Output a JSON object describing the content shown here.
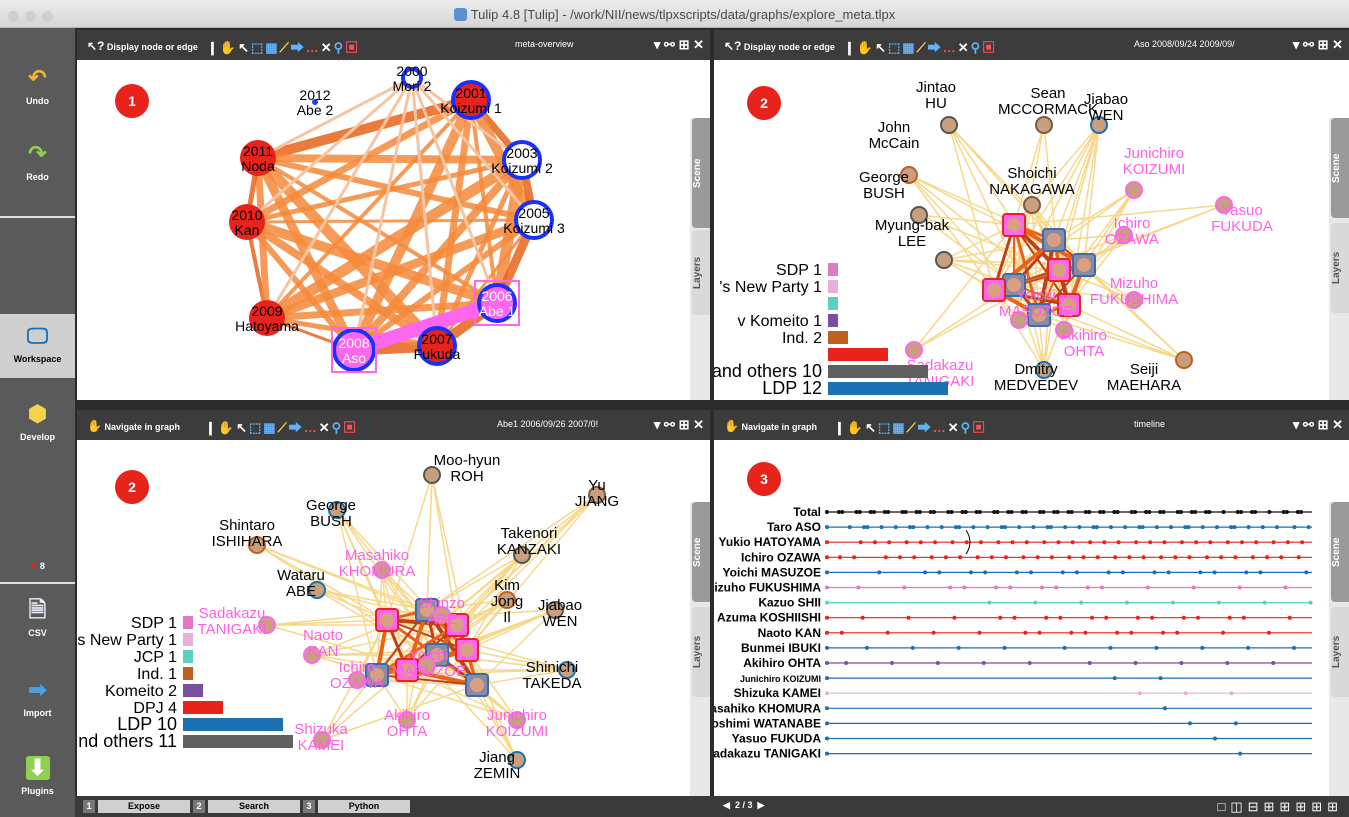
{
  "window": {
    "title": "Tulip 4.8 [Tulip] - /work/NII/news/tlpxscripts/data/graphs/explore_meta.tlpx"
  },
  "sidebar": {
    "undo": "Undo",
    "redo": "Redo",
    "workspace": "Workspace",
    "develop": "Develop",
    "errors": "8",
    "csv": "CSV",
    "import": "Import",
    "plugins": "Plugins"
  },
  "panels": {
    "p1": {
      "mode": "Display node or edge",
      "graph": "meta-overview",
      "badge": "1"
    },
    "p2": {
      "mode": "Display node or edge",
      "graph": "Aso 2008/09/24 2009/09/",
      "badge": "2"
    },
    "p3": {
      "mode": "Navigate in graph",
      "graph": "Abe1 2006/09/26 2007/0!",
      "badge": "2"
    },
    "p4": {
      "mode": "Navigate in graph",
      "graph": "timeline",
      "badge": "3"
    },
    "tabs": {
      "scene": "Scene",
      "layers": "Layers"
    }
  },
  "overview_nodes": [
    {
      "line1": "2000",
      "line2": "Mori 2"
    },
    {
      "line1": "2001",
      "line2": "Koizumi 1"
    },
    {
      "line1": "2003",
      "line2": "Koizumi 2"
    },
    {
      "line1": "2005",
      "line2": "Koizumi 3"
    },
    {
      "line1": "2006",
      "line2": "Abe 1"
    },
    {
      "line1": "2007",
      "line2": "Fukuda"
    },
    {
      "line1": "2008",
      "line2": "Aso"
    },
    {
      "line1": "2009",
      "line2": "Hatoyama"
    },
    {
      "line1": "2010",
      "line2": "Kan"
    },
    {
      "line1": "2011",
      "line2": "Noda"
    },
    {
      "line1": "2012",
      "line2": "Abe 2"
    }
  ],
  "aso_legend": [
    {
      "label": "SDP 1",
      "color": "#e07ac0",
      "value": 1
    },
    {
      "label": "'s New Party 1",
      "color": "#e8b0d8",
      "value": 1
    },
    {
      "label": "",
      "color": "#5ccfc0",
      "value": 1
    },
    {
      "label": "v Komeito 1",
      "color": "#7b4fa0",
      "value": 1
    },
    {
      "label": "Ind. 2",
      "color": "#c06020",
      "value": 2
    },
    {
      "label": "",
      "color": "#e8231b",
      "value": 6
    },
    {
      "label": "and others 10",
      "color": "#606060",
      "value": 10
    },
    {
      "label": "LDP 12",
      "color": "#1a70b0",
      "value": 12
    }
  ],
  "aso_people": [
    {
      "name": "Jintao\nHU",
      "pink": false
    },
    {
      "name": "Sean\nMCCORMACK",
      "pink": false
    },
    {
      "name": "Jiabao\nWEN",
      "pink": false
    },
    {
      "name": "John\nMcCain",
      "pink": false
    },
    {
      "name": "George\nBUSH",
      "pink": false
    },
    {
      "name": "Shoichi\nNAKAGAWA",
      "pink": false
    },
    {
      "name": "Junichiro\nKOIZUMI",
      "pink": true
    },
    {
      "name": "Yasuo\nFUKUDA",
      "pink": true
    },
    {
      "name": "Myung-bak\nLEE",
      "pink": false
    },
    {
      "name": "Ichiro\nOZAWA",
      "pink": true
    },
    {
      "name": "Mizuho\nFUKUSHIMA",
      "pink": true
    },
    {
      "name": "Yoichi\nMASUZOE",
      "pink": true
    },
    {
      "name": "Akihiro\nOHTA",
      "pink": true
    },
    {
      "name": "Sadakazu\nTANIGAKI",
      "pink": true
    },
    {
      "name": "Dmitry\nMEDVEDEV",
      "pink": false
    },
    {
      "name": "Seiji\nMAEHARA",
      "pink": false
    }
  ],
  "abe_legend": [
    {
      "label": "SDP 1",
      "color": "#e07ac0",
      "value": 1
    },
    {
      "label": "s New Party 1",
      "color": "#e8b0d8",
      "value": 1
    },
    {
      "label": "JCP 1",
      "color": "#5ccfc0",
      "value": 1
    },
    {
      "label": "Ind. 1",
      "color": "#c06020",
      "value": 1
    },
    {
      "label": "Komeito 2",
      "color": "#7b4fa0",
      "value": 2
    },
    {
      "label": "DPJ 4",
      "color": "#e8231b",
      "value": 4
    },
    {
      "label": "LDP 10",
      "color": "#1a70b0",
      "value": 10
    },
    {
      "label": "nd others 11",
      "color": "#606060",
      "value": 11
    }
  ],
  "abe_people": [
    {
      "name": "Moo-hyun\nROH",
      "pink": false
    },
    {
      "name": "Yu\nJIANG",
      "pink": false
    },
    {
      "name": "George\nBUSH",
      "pink": false
    },
    {
      "name": "Shintaro\nISHIHARA",
      "pink": false
    },
    {
      "name": "Takenori\nKANZAKI",
      "pink": false
    },
    {
      "name": "Masahiko\nKHOMURA",
      "pink": true
    },
    {
      "name": "Wataru\nABE",
      "pink": false
    },
    {
      "name": "Kim\nJong\nIl",
      "pink": false
    },
    {
      "name": "Jiabao\nWEN",
      "pink": false
    },
    {
      "name": "Sadakazu\nTANIGAKI",
      "pink": true
    },
    {
      "name": "Naoto\nKAN",
      "pink": true
    },
    {
      "name": "Ichiro\nOZAWA",
      "pink": true
    },
    {
      "name": "Shinzo\nABE",
      "pink": true
    },
    {
      "name": "Yoichi\nMASUZOE",
      "pink": true
    },
    {
      "name": "Shinichi\nTAKEDA",
      "pink": false
    },
    {
      "name": "Shizuka\nKAMEI",
      "pink": true
    },
    {
      "name": "Akihiro\nOHTA",
      "pink": true
    },
    {
      "name": "Junichiro\nKOIZUMI",
      "pink": true
    },
    {
      "name": "Jiang\nZEMIN",
      "pink": false
    }
  ],
  "timeline": [
    {
      "name": "Total",
      "color": "#111111"
    },
    {
      "name": "Taro ASO",
      "color": "#1a70b0"
    },
    {
      "name": "Yukio HATOYAMA",
      "color": "#e8231b"
    },
    {
      "name": "Ichiro OZAWA",
      "color": "#e8231b"
    },
    {
      "name": "Yoichi MASUZOE",
      "color": "#1a70b0"
    },
    {
      "name": "Mizuho FUKUSHIMA",
      "color": "#e07ac0"
    },
    {
      "name": "Kazuo SHII",
      "color": "#5ccfc0"
    },
    {
      "name": "Azuma KOSHIISHI",
      "color": "#e8231b"
    },
    {
      "name": "Naoto KAN",
      "color": "#e8231b"
    },
    {
      "name": "Bunmei IBUKI",
      "color": "#1a70b0"
    },
    {
      "name": "Akihiro OHTA",
      "color": "#7b4fa0"
    },
    {
      "name": "Junichiro KOIZUMI",
      "color": "#1a70b0"
    },
    {
      "name": "Shizuka KAMEI",
      "color": "#e8b0d8"
    },
    {
      "name": "Masahiko KHOMURA",
      "color": "#1a70b0"
    },
    {
      "name": "Yoshimi WATANABE",
      "color": "#1a70b0"
    },
    {
      "name": "Yasuo FUKUDA",
      "color": "#1a70b0"
    },
    {
      "name": "Sadakazu TANIGAKI",
      "color": "#1a70b0"
    }
  ],
  "bottom": {
    "tabs": [
      {
        "n": "1",
        "label": "Expose"
      },
      {
        "n": "2",
        "label": "Search"
      },
      {
        "n": "3",
        "label": "Python"
      }
    ],
    "pager": "2 / 3"
  }
}
